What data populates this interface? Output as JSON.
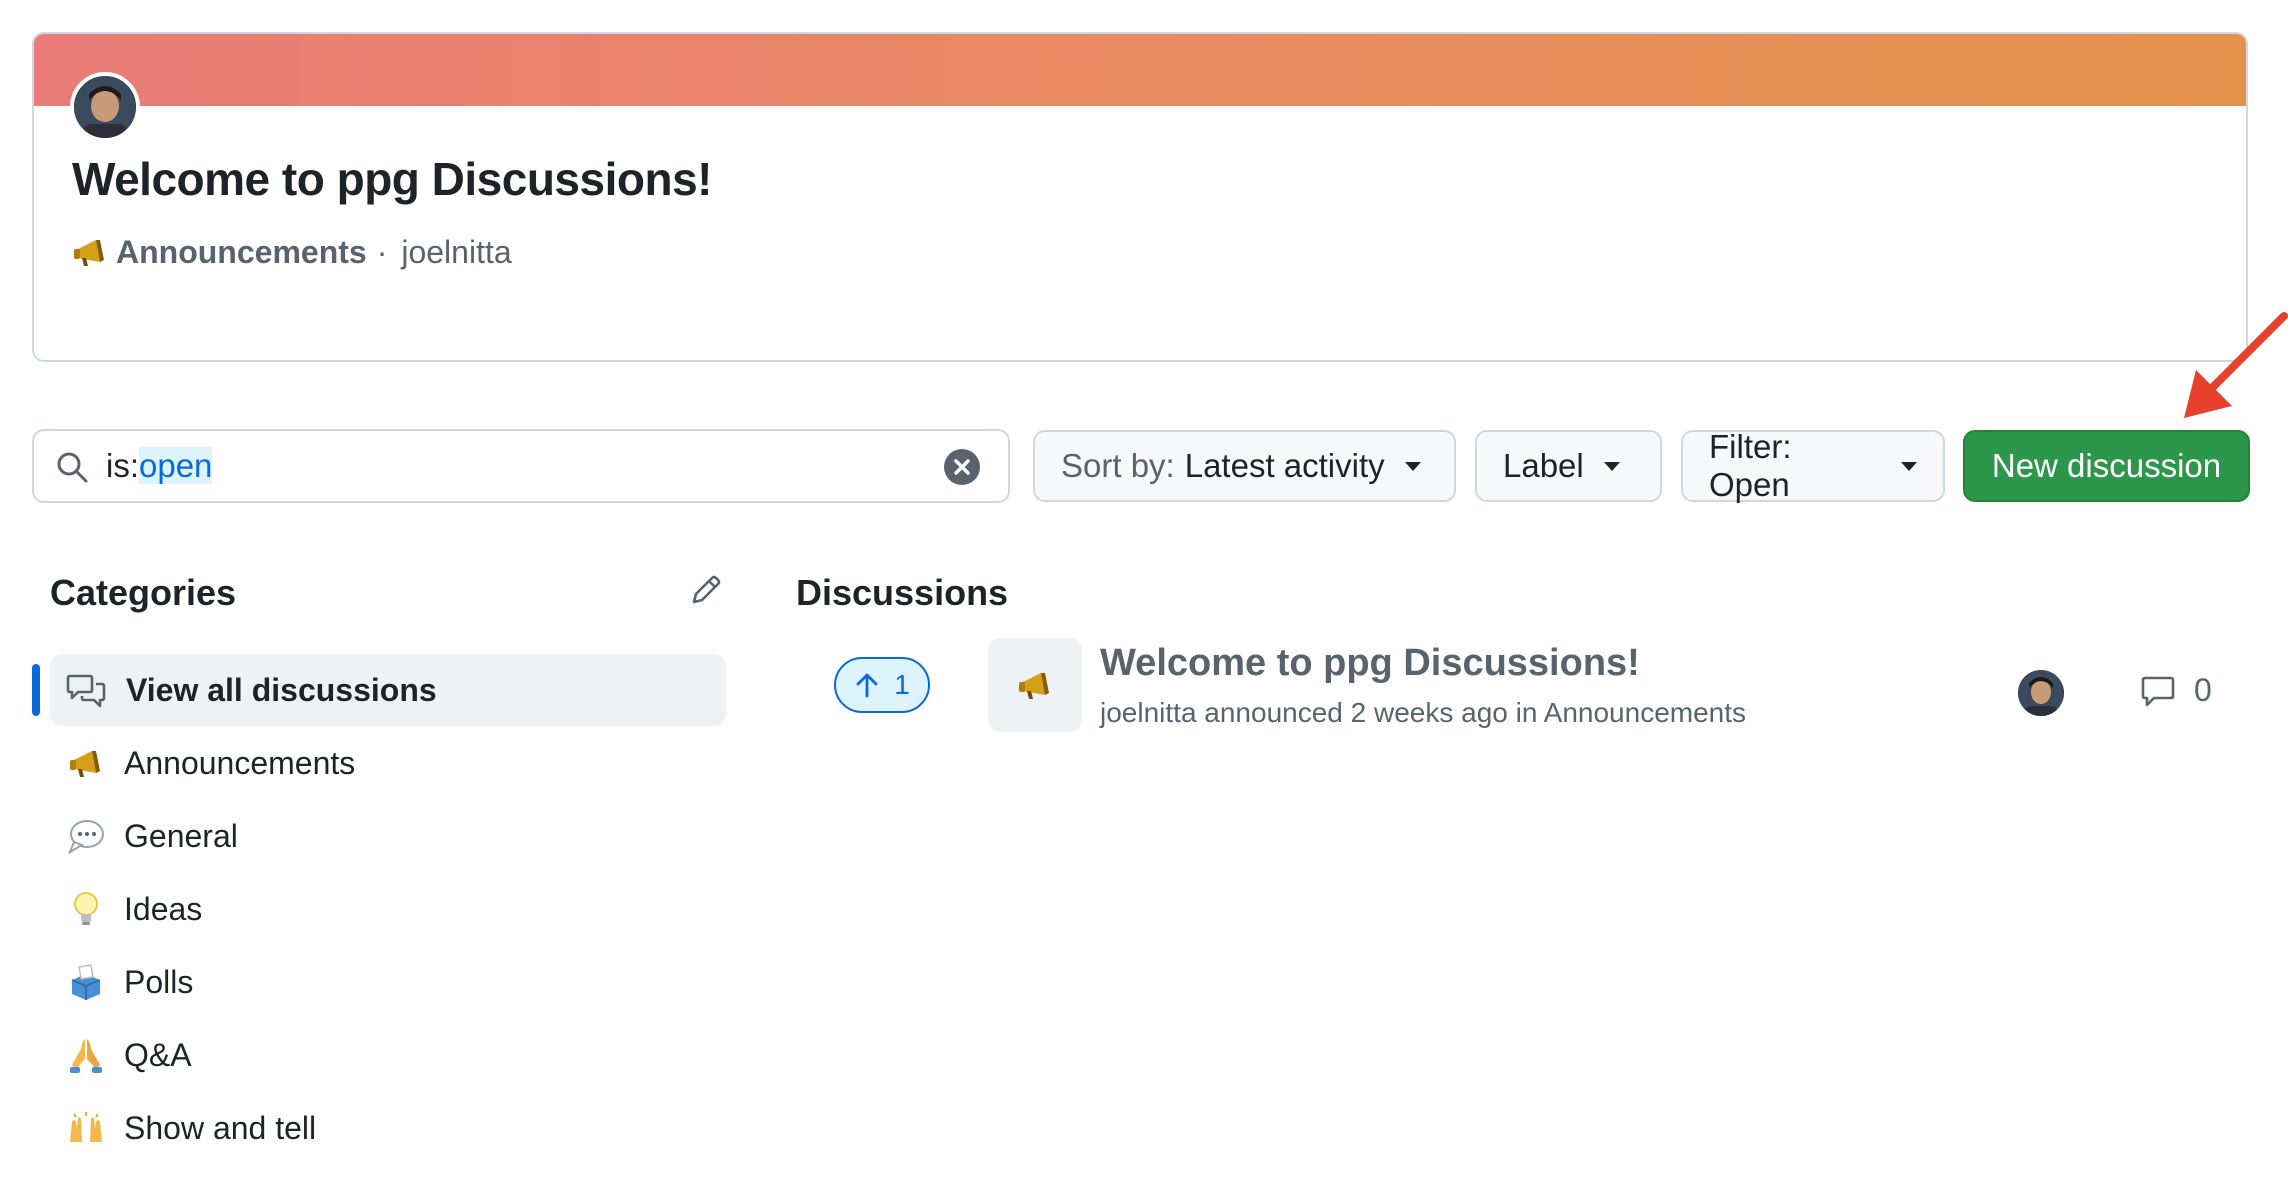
{
  "featured": {
    "title": "Welcome to ppg Discussions!",
    "category": "Announcements",
    "separator": "·",
    "author": "joelnitta"
  },
  "search": {
    "prefix": "is:",
    "value": "open"
  },
  "toolbar": {
    "sort_prefix": "Sort by:",
    "sort_value": "Latest activity",
    "label": "Label",
    "filter": "Filter: Open",
    "new_discussion": "New discussion"
  },
  "sidebar": {
    "heading": "Categories",
    "items": [
      {
        "label": "View all discussions",
        "icon": "discussions-icon"
      },
      {
        "label": "Announcements",
        "icon": "megaphone-icon"
      },
      {
        "label": "General",
        "icon": "speech-bubble-icon"
      },
      {
        "label": "Ideas",
        "icon": "lightbulb-icon"
      },
      {
        "label": "Polls",
        "icon": "ballot-box-icon"
      },
      {
        "label": "Q&A",
        "icon": "folded-hands-icon"
      },
      {
        "label": "Show and tell",
        "icon": "raised-hands-icon"
      }
    ]
  },
  "discussions": {
    "heading": "Discussions",
    "items": [
      {
        "votes": "1",
        "title": "Welcome to ppg Discussions!",
        "meta": "joelnitta announced 2 weeks ago in Announcements",
        "comments": "0"
      }
    ]
  },
  "colors": {
    "accent": "#0969da",
    "primary_button": "#2c974b",
    "annotation_arrow": "#e8412b"
  }
}
